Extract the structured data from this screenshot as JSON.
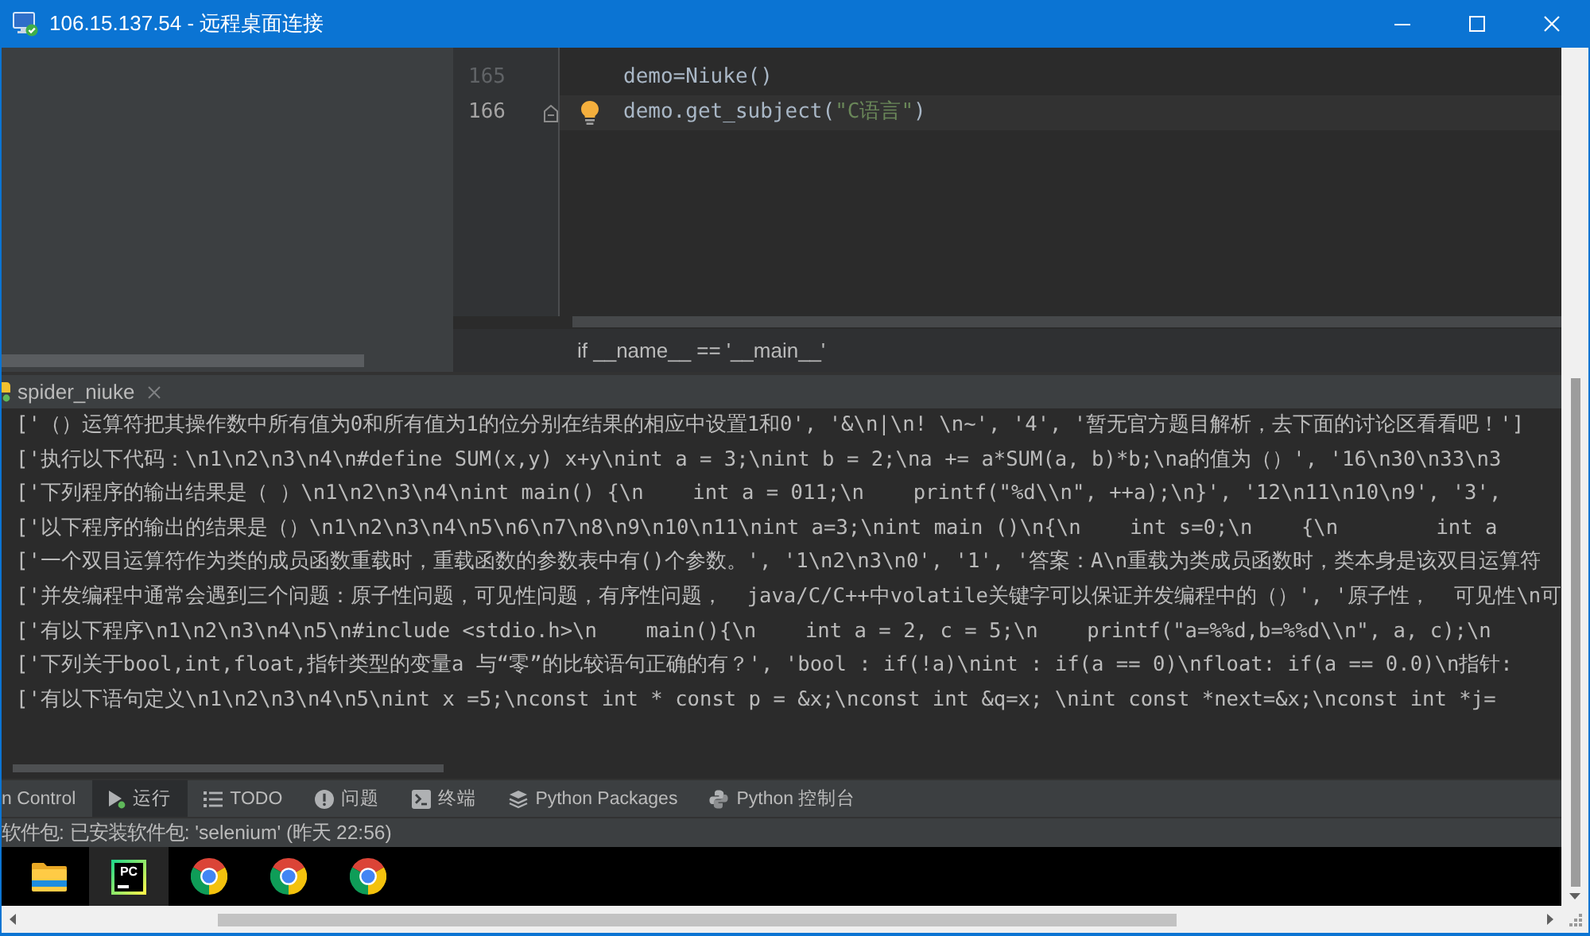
{
  "window": {
    "title": "106.15.137.54 - 远程桌面连接"
  },
  "editor": {
    "lines": [
      {
        "number": "165",
        "current": false,
        "bulb": false,
        "fold_marker": false,
        "tokens": [
          {
            "kind": "plain",
            "text": "demo=Niuke()"
          }
        ]
      },
      {
        "number": "166",
        "current": true,
        "bulb": true,
        "fold_marker": true,
        "tokens": [
          {
            "kind": "plain",
            "text": "demo.get_subject("
          },
          {
            "kind": "string",
            "text": "\"C语言\""
          },
          {
            "kind": "plain",
            "text": ")"
          }
        ]
      }
    ],
    "breadcrumb": "if __name__ == '__main__'"
  },
  "run_panel": {
    "tab": {
      "label": "spider_niuke"
    },
    "output": [
      "['（）运算符把其操作数中所有值为0和所有值为1的位分别在结果的相应中设置1和0', '&\\n|\\n! \\n~', '4', '暂无官方题目解析，去下面的讨论区看看吧！']",
      "['执行以下代码：\\n1\\n2\\n3\\n4\\n#define SUM(x,y) x+y\\nint a = 3;\\nint b = 2;\\na += a*SUM(a, b)*b;\\na的值为（）', '16\\n30\\n33\\n3",
      "['下列程序的输出结果是（ ）\\n1\\n2\\n3\\n4\\nint main() {\\n    int a = 011;\\n    printf(\"%d\\\\n\", ++a);\\n}', '12\\n11\\n10\\n9', '3',",
      "['以下程序的输出的结果是（）\\n1\\n2\\n3\\n4\\n5\\n6\\n7\\n8\\n9\\n10\\n11\\nint a=3;\\nint main ()\\n{\\n    int s=0;\\n    {\\n        int a",
      "['一个双目运算符作为类的成员函数重载时，重载函数的参数表中有()个参数。', '1\\n2\\n3\\n0', '1', '答案：A\\n重载为类成员函数时，类本身是该双目运算符",
      "['并发编程中通常会遇到三个问题：原子性问题，可见性问题，有序性问题，  java/C/C++中volatile关键字可以保证并发编程中的（）', '原子性，  可见性\\n可",
      "['有以下程序\\n1\\n2\\n3\\n4\\n5\\n#include <stdio.h>\\n    main(){\\n    int a = 2, c = 5;\\n    printf(\"a=%%d,b=%%d\\\\n\", a, c);\\n",
      "['下列关于bool,int,float,指针类型的变量a 与“零”的比较语句正确的有？', 'bool : if(!a)\\nint : if(a == 0)\\nfloat: if(a == 0.0)\\n指针:",
      "['有以下语句定义\\n1\\n2\\n3\\n4\\n5\\nint x =5;\\nconst int * const p = &x;\\nconst int &q=x; \\nint const *next=&x;\\nconst int *j="
    ]
  },
  "tool_windows": [
    {
      "label": "n Control",
      "kind": "vcs",
      "selected": false
    },
    {
      "label": "运行",
      "kind": "run",
      "selected": true
    },
    {
      "label": "TODO",
      "kind": "todo",
      "selected": false
    },
    {
      "label": "问题",
      "kind": "problems",
      "selected": false
    },
    {
      "label": "终端",
      "kind": "terminal",
      "selected": false
    },
    {
      "label": "Python Packages",
      "kind": "packages",
      "selected": false
    },
    {
      "label": "Python 控制台",
      "kind": "console",
      "selected": false
    }
  ],
  "status_bar": {
    "message": "软件包: 已安装软件包: 'selenium' (昨天 22:56)"
  },
  "taskbar": {
    "apps": [
      {
        "kind": "folder",
        "selected": false
      },
      {
        "kind": "ide",
        "label": "PC",
        "selected": true
      },
      {
        "kind": "browser",
        "selected": false
      },
      {
        "kind": "browser",
        "selected": false
      },
      {
        "kind": "browser",
        "selected": false
      }
    ]
  }
}
